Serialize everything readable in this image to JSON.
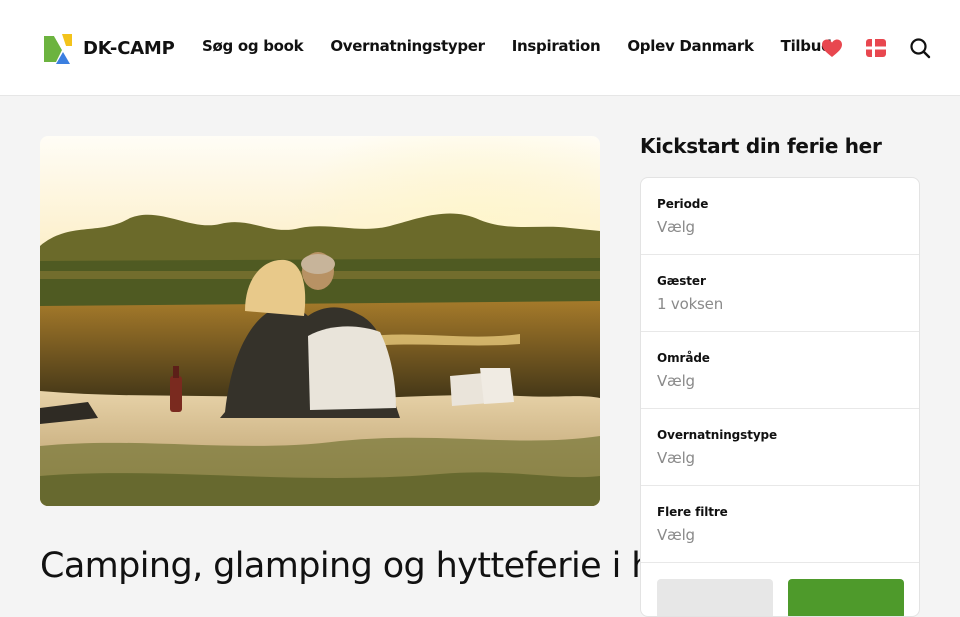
{
  "brand": {
    "name": "DK-CAMP",
    "colors": {
      "green": "#4e9a2b",
      "heart": "#e8474f",
      "flag": "#e8474f",
      "logo_green": "#6cb33f",
      "logo_yellow": "#f3c31b",
      "logo_blue": "#3b7fe0"
    }
  },
  "nav": {
    "items": [
      {
        "label": "Søg og book"
      },
      {
        "label": "Overnatningstyper"
      },
      {
        "label": "Inspiration"
      },
      {
        "label": "Oplev Danmark"
      },
      {
        "label": "Tilbud"
      }
    ]
  },
  "header_icons": [
    "heart-icon",
    "danish-flag-icon",
    "search-icon"
  ],
  "hero": {
    "heading": "Camping, glamping og hytteferie i hele Danmark",
    "image": "couple-sitting-by-lake-at-sunset"
  },
  "booking": {
    "title": "Kickstart din ferie her",
    "fields": [
      {
        "label": "Periode",
        "value": "Vælg"
      },
      {
        "label": "Gæster",
        "value": "1 voksen"
      },
      {
        "label": "Område",
        "value": "Vælg"
      },
      {
        "label": "Overnatningstype",
        "value": "Vælg"
      },
      {
        "label": "Flere filtre",
        "value": "Vælg"
      }
    ],
    "buttons": [
      "reset-button",
      "search-button"
    ]
  }
}
